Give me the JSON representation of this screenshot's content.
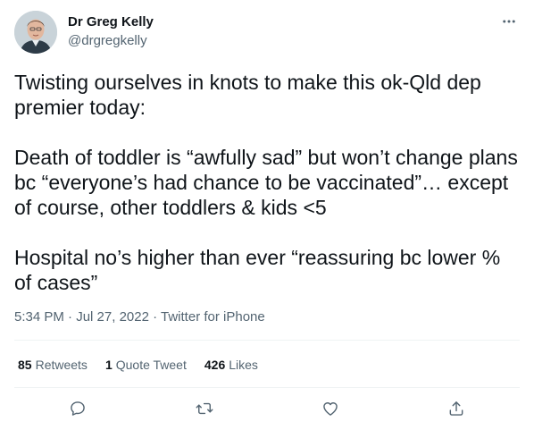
{
  "author": {
    "name": "Dr Greg Kelly",
    "handle": "@drgregkelly",
    "avatar_icon": "profile-photo"
  },
  "tweet": {
    "text": "Twisting ourselves in knots to make this ok-Qld dep premier today:\n\nDeath of toddler is “awfully sad” but won’t change plans bc “everyone’s had chance to be vaccinated”… except of course, other toddlers & kids <5\n\nHospital no’s higher than ever “reassuring bc lower % of cases”",
    "time": "5:34 PM",
    "separator1": " · ",
    "date": "Jul 27, 2022",
    "separator2": " · ",
    "source": "Twitter for iPhone"
  },
  "stats": {
    "retweets_count": "85",
    "retweets_label": "Retweets",
    "quotes_count": "1",
    "quotes_label": "Quote Tweet",
    "likes_count": "426",
    "likes_label": "Likes"
  },
  "icons": {
    "more": "more-icon",
    "reply": "reply-icon",
    "retweet": "retweet-icon",
    "like": "like-icon",
    "share": "share-icon"
  },
  "colors": {
    "text_primary": "#0f1419",
    "text_secondary": "#536471",
    "divider": "#eff3f4"
  }
}
